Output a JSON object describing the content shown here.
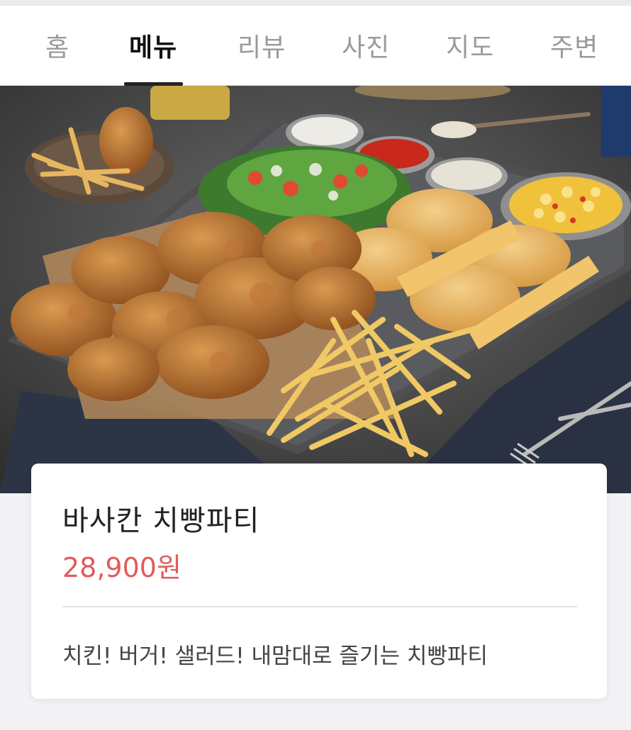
{
  "tabs": [
    {
      "label": "홈",
      "active": false
    },
    {
      "label": "메뉴",
      "active": true
    },
    {
      "label": "리뷰",
      "active": false
    },
    {
      "label": "사진",
      "active": false
    },
    {
      "label": "지도",
      "active": false
    },
    {
      "label": "주변",
      "active": false
    }
  ],
  "hero_image": {
    "icon": "food-photo"
  },
  "menu": {
    "name": "바사칸 치빵파티",
    "price": "28,900원",
    "description": "치킨! 버거! 샐러드! 내맘대로 즐기는 치빵파티"
  },
  "colors": {
    "price": "#e25b5b",
    "active_tab": "#111111",
    "inactive_tab": "#9a9a9a"
  }
}
